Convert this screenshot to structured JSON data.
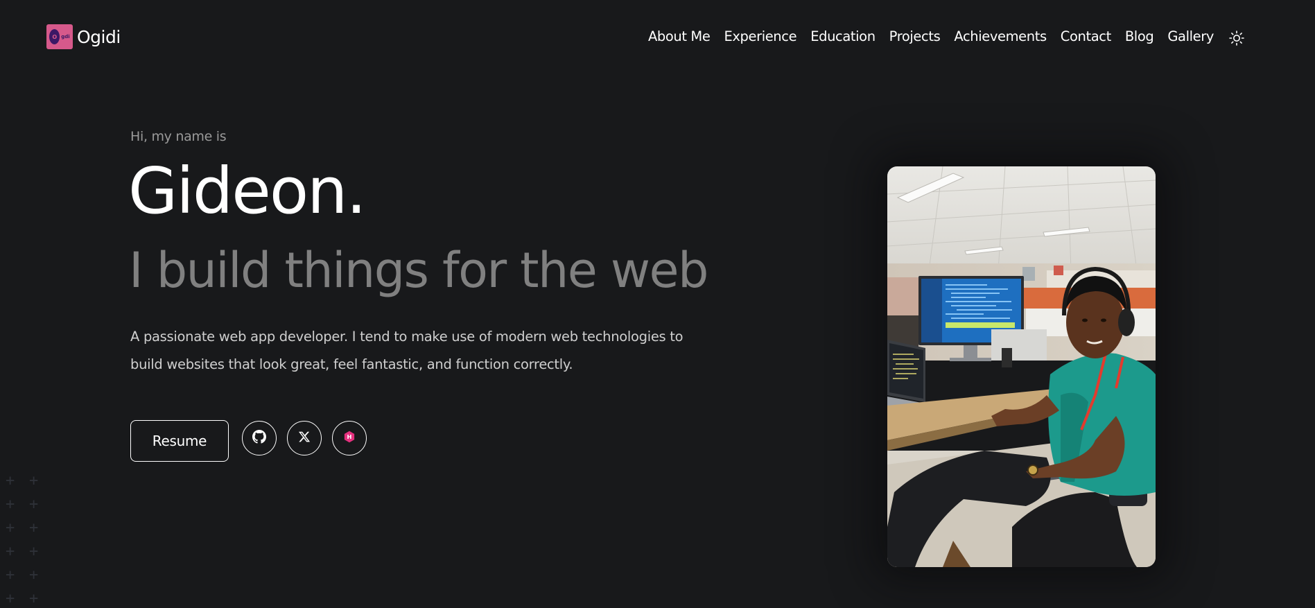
{
  "header": {
    "logo_text": "Ogidi",
    "logo_mark_letter": "O",
    "logo_mark_small": "gdi",
    "nav": [
      "About Me",
      "Experience",
      "Education",
      "Projects",
      "Achievements",
      "Contact",
      "Blog",
      "Gallery"
    ],
    "theme_toggle_icon": "sun-icon"
  },
  "hero": {
    "greeting": "Hi, my name is",
    "name": "Gideon.",
    "tagline": "I build things for the web",
    "bio": "A passionate web app developer. I tend to make use of modern web technologies to build websites that look great, feel fantastic, and function correctly.",
    "resume_label": "Resume",
    "socials": [
      {
        "icon": "github-icon"
      },
      {
        "icon": "x-icon"
      },
      {
        "icon": "hashnode-icon",
        "letter": "H",
        "color": "#e5307e"
      }
    ]
  },
  "photo": {
    "icon": "portrait-photo"
  },
  "colors": {
    "background": "#18191b",
    "text_primary": "#ffffff",
    "text_muted": "#808080",
    "logo_bg": "#d6598b",
    "hashnode_pink": "#e5307e"
  }
}
